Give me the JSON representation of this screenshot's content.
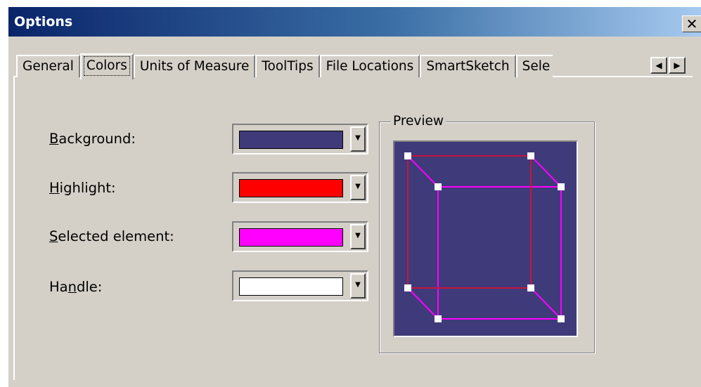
{
  "window": {
    "title": "Options",
    "close_glyph": "✕"
  },
  "tabs": [
    {
      "label": "General",
      "selected": false
    },
    {
      "label": "Colors",
      "selected": true
    },
    {
      "label": "Units of Measure",
      "selected": false
    },
    {
      "label": "ToolTips",
      "selected": false
    },
    {
      "label": "File Locations",
      "selected": false
    },
    {
      "label": "SmartSketch",
      "selected": false
    },
    {
      "label": "Sele",
      "selected": false
    }
  ],
  "tab_scroll": {
    "left": "◀",
    "right": "▶"
  },
  "colors": {
    "background": {
      "label": "Background:",
      "mnemonic": "B",
      "value": "#3f3a7a"
    },
    "highlight": {
      "label": "Highlight:",
      "mnemonic": "H",
      "value": "#ff0000"
    },
    "selected_element": {
      "label": "Selected element:",
      "mnemonic": "S",
      "value": "#ff00ff"
    },
    "handle": {
      "label": "Handle:",
      "mnemonic": "n",
      "value": "#ffffff"
    }
  },
  "preview": {
    "label": "Preview",
    "background_color": "#3f3a7a",
    "highlight_color": "#c8143c",
    "selected_color": "#ff00ff",
    "handle_color": "#ffffff"
  },
  "icons": {
    "dropdown": "chevron-down-icon",
    "close": "close-icon",
    "scroll_left": "arrow-left-icon",
    "scroll_right": "arrow-right-icon"
  }
}
